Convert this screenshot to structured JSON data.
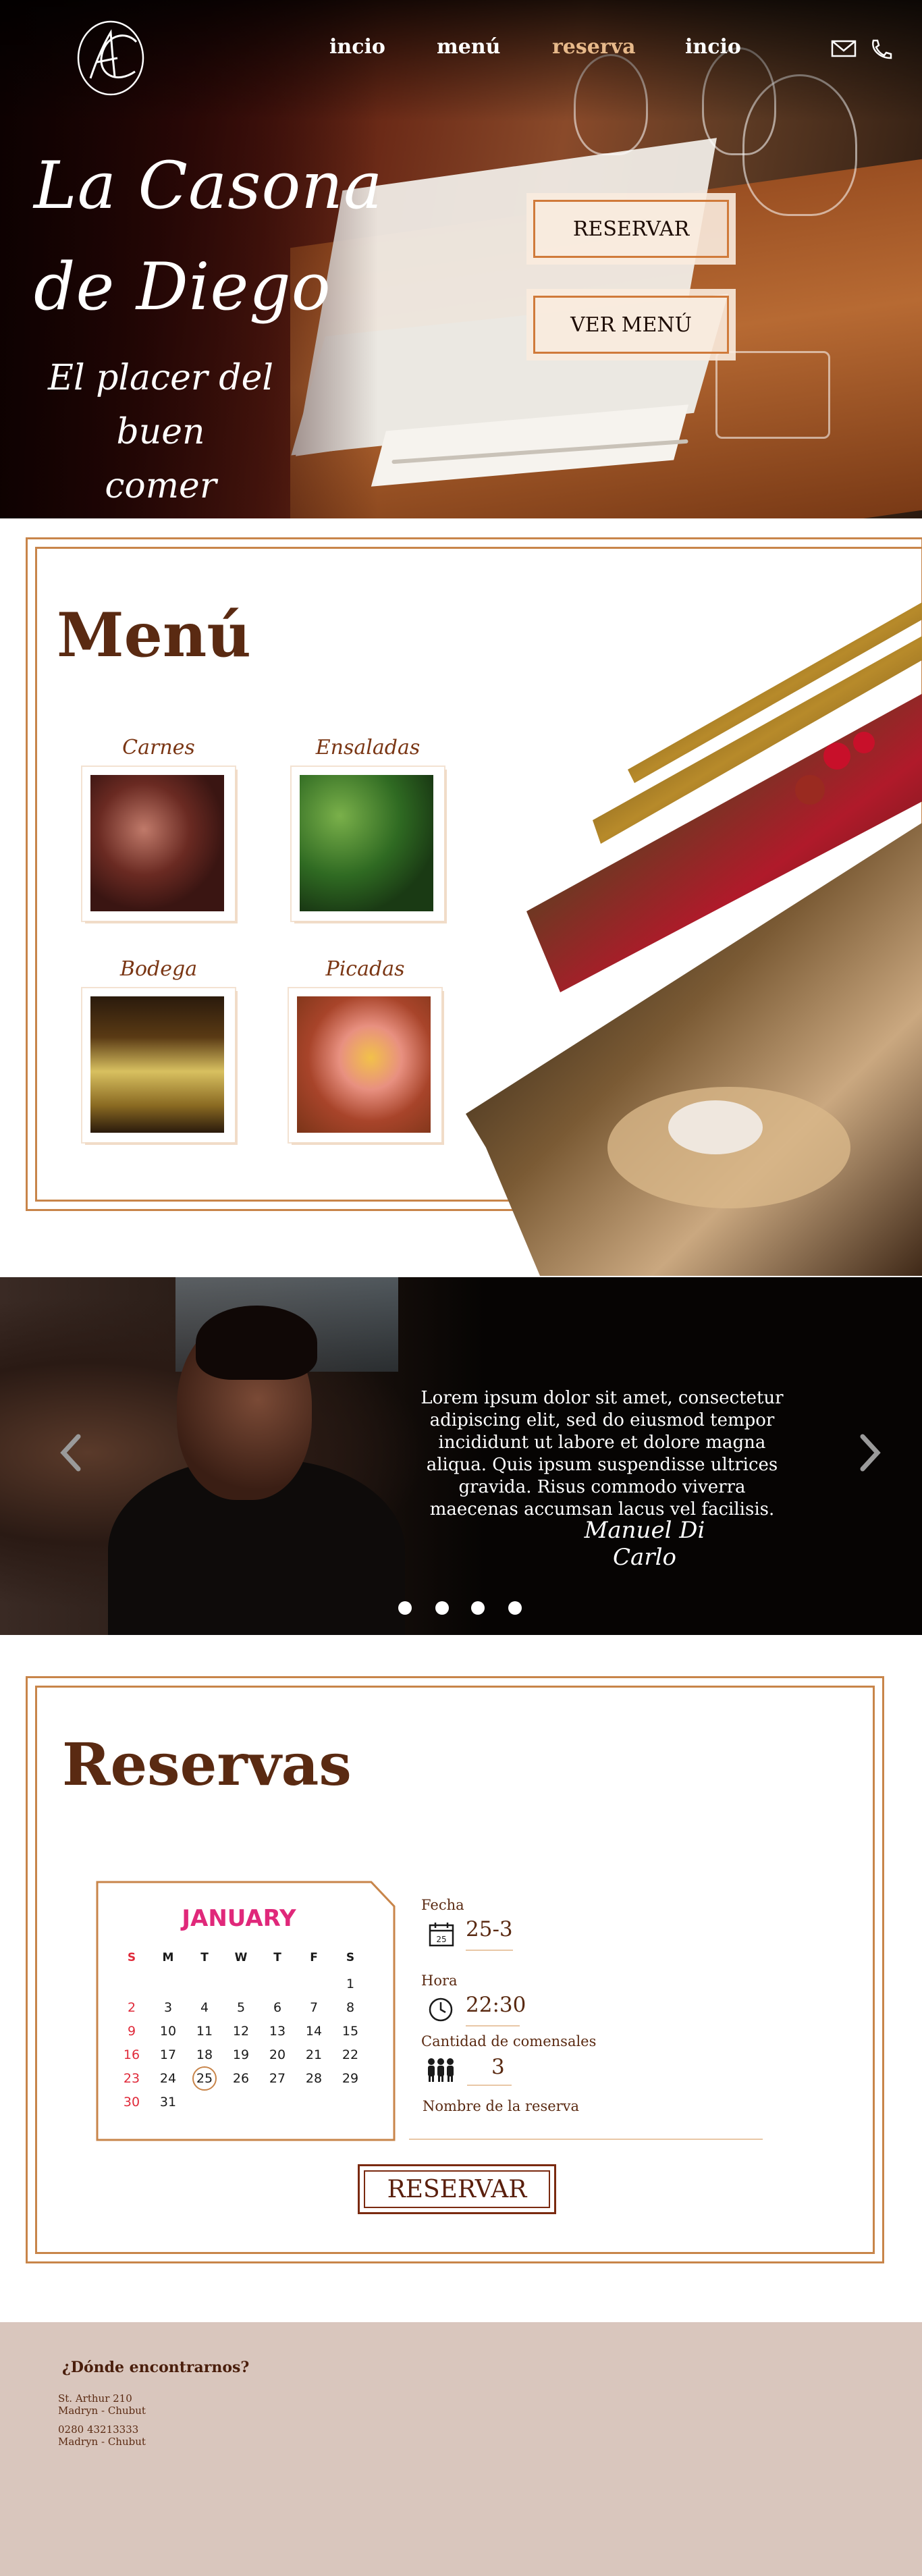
{
  "header": {
    "logo_text": "LC",
    "nav": [
      {
        "label": "incio",
        "active": false
      },
      {
        "label": "menú",
        "active": false
      },
      {
        "label": "reserva",
        "active": true
      },
      {
        "label": "incio",
        "active": false
      }
    ],
    "icons": [
      "mail-icon",
      "phone-icon"
    ],
    "accent_color": "#e7b98a"
  },
  "hero": {
    "title_line1": "La Casona",
    "title_line2": "de Diego",
    "subtitle_line1": "El placer del buen",
    "subtitle_line2": "comer",
    "buttons": [
      "RESERVAR",
      "VER MENÚ"
    ]
  },
  "menu": {
    "title": "Menú",
    "cards": [
      {
        "label": "Carnes"
      },
      {
        "label": "Ensaladas"
      },
      {
        "label": "Bodega"
      },
      {
        "label": "Picadas"
      }
    ]
  },
  "testimonial": {
    "text": "Lorem ipsum dolor sit amet, consectetur adipiscing elit, sed do eiusmod tempor incididunt ut labore et dolore magna aliqua. Quis ipsum suspendisse ultrices gravida. Risus commodo viverra maecenas accumsan lacus vel facilisis.",
    "signature": "Manuel Di Carlo",
    "prev": "‹",
    "next": "›",
    "slides": 4
  },
  "reservas": {
    "title": "Reservas",
    "calendar": {
      "month": "JANUARY",
      "days_header": [
        "S",
        "M",
        "T",
        "W",
        "T",
        "F",
        "S"
      ],
      "weeks": [
        [
          "",
          "",
          "",
          "",
          "",
          "",
          "1"
        ],
        [
          "2",
          "3",
          "4",
          "5",
          "6",
          "7",
          "8"
        ],
        [
          "9",
          "10",
          "11",
          "12",
          "13",
          "14",
          "15"
        ],
        [
          "16",
          "17",
          "18",
          "19",
          "20",
          "21",
          "22"
        ],
        [
          "23",
          "24",
          "25",
          "26",
          "27",
          "28",
          "29"
        ],
        [
          "30",
          "31",
          "",
          "",
          "",
          "",
          ""
        ]
      ],
      "selected_day": "25"
    },
    "fecha_label": "Fecha",
    "fecha_value": "25-3",
    "fecha_icon_text": "25",
    "hora_label": "Hora",
    "hora_value": "22:30",
    "comensales_label": "Cantidad de comensales",
    "comensales_value": "3",
    "nombre_label": "Nombre de la reserva",
    "nombre_value": "",
    "button": "RESERVAR"
  },
  "footer": {
    "question": "¿Dónde encontrarnos?",
    "address_line1": "St. Arthur 210",
    "address_line2": "Madryn - Chubut",
    "phone_line1": "0280 43213333",
    "phone_line2": "Madryn - Chubut",
    "background_color": "#d9c6bd"
  }
}
